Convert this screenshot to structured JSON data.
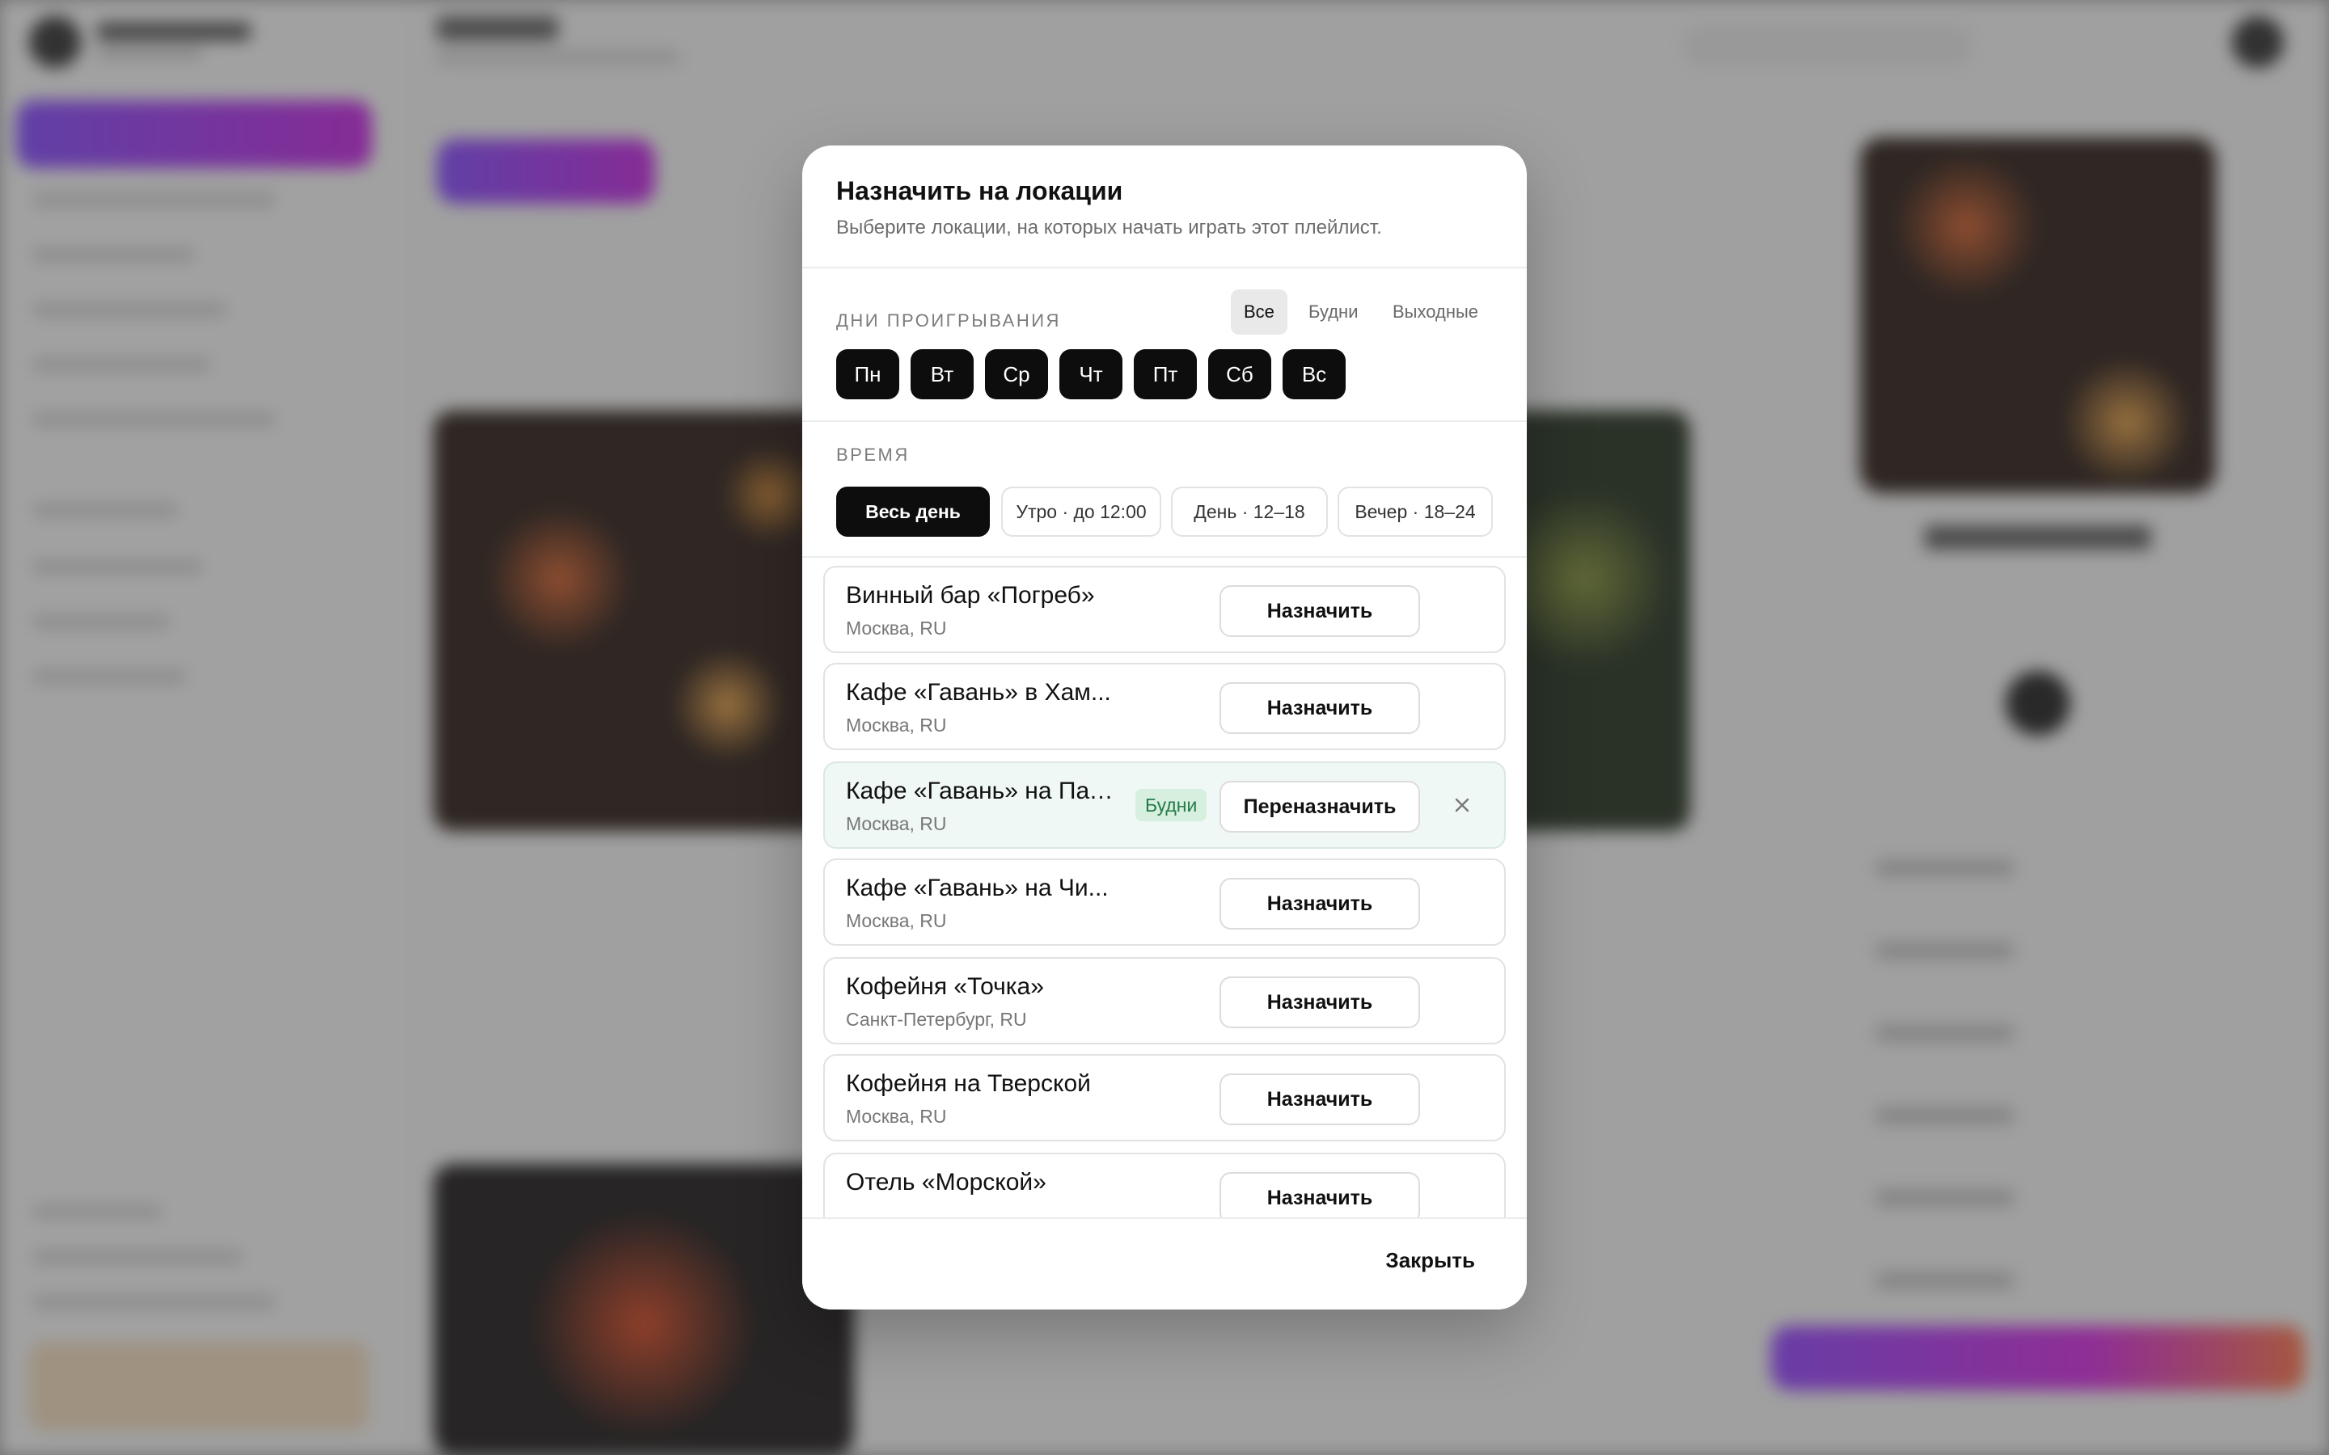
{
  "modal": {
    "title": "Назначить на локации",
    "subtitle": "Выберите локации, на которых начать играть этот плейлист.",
    "close_label": "Закрыть"
  },
  "days": {
    "label": "Дни проигрывания",
    "filters": [
      {
        "label": "Все",
        "active": true
      },
      {
        "label": "Будни",
        "active": false
      },
      {
        "label": "Выходные",
        "active": false
      }
    ],
    "chips": [
      "Пн",
      "Вт",
      "Ср",
      "Чт",
      "Пт",
      "Сб",
      "Вс"
    ]
  },
  "time": {
    "label": "Время",
    "options": [
      {
        "label": "Весь день",
        "active": true
      },
      {
        "label": "Утро · до 12:00",
        "active": false
      },
      {
        "label": "День · 12–18",
        "active": false
      },
      {
        "label": "Вечер · 18–24",
        "active": false
      }
    ]
  },
  "locations": [
    {
      "name": "Винный бар «Погреб»",
      "city": "Москва, RU",
      "action": "Назначить",
      "badge": "",
      "assigned": false
    },
    {
      "name": "Кафе «Гавань» в Хам...",
      "city": "Москва, RU",
      "action": "Назначить",
      "badge": "",
      "assigned": false
    },
    {
      "name": "Кафе «Гавань» на Патр...",
      "city": "Москва, RU",
      "action": "Переназначить",
      "badge": "Будни",
      "assigned": true
    },
    {
      "name": "Кафе «Гавань» на Чи...",
      "city": "Москва, RU",
      "action": "Назначить",
      "badge": "",
      "assigned": false
    },
    {
      "name": "Кофейня «Точка»",
      "city": "Санкт-Петербург, RU",
      "action": "Назначить",
      "badge": "",
      "assigned": false
    },
    {
      "name": "Кофейня на Тверской",
      "city": "Москва, RU",
      "action": "Назначить",
      "badge": "",
      "assigned": false
    },
    {
      "name": "Отель «Морской»",
      "city": "",
      "action": "Назначить",
      "badge": "",
      "assigned": false
    }
  ],
  "icons": {
    "remove": "close-icon"
  },
  "colors": {
    "accent_gradient_start": "#7a3cff",
    "accent_gradient_end": "#c214e0",
    "assigned_badge_bg": "#d7efdf",
    "assigned_badge_text": "#247a48"
  }
}
